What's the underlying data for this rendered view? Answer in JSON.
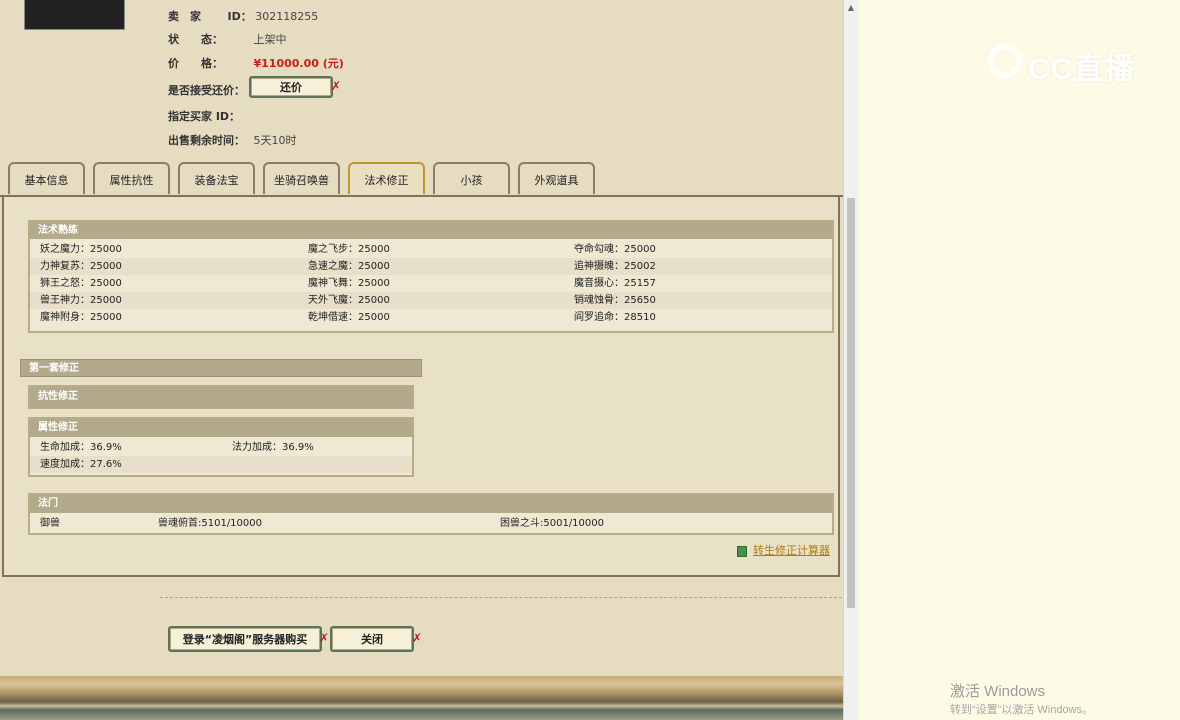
{
  "seller": {
    "seller_label": "卖　家",
    "seller_id_label": "ID：",
    "seller_id": "302118255",
    "status_label": "状　　态：",
    "status_value": "上架中",
    "price_label": "价　　格：",
    "price_value": "¥11000.00 (元)",
    "counter_label": "是否接受还价：",
    "counter_button": "还价",
    "buyer_label": "指定买家 ID：",
    "remaining_label": "出售剩余时间：",
    "remaining_value": "5天10时"
  },
  "tabs": [
    "基本信息",
    "属性抗性",
    "装备法宝",
    "坐骑召唤兽",
    "法术修正",
    "小孩",
    "外观道具"
  ],
  "active_tab": "法术修正",
  "spell_mastery": {
    "title": "法术熟练",
    "rows": [
      [
        "妖之魔力：25000",
        "魔之飞步：25000",
        "夺命勾魂：25000"
      ],
      [
        "力神复苏：25000",
        "急速之魔：25000",
        "追神摄魄：25002"
      ],
      [
        "狮王之怒：25000",
        "魔神飞舞：25000",
        "魔音摄心：25157"
      ],
      [
        "兽王神力：25000",
        "天外飞魔：25000",
        "销魂蚀骨：25650"
      ],
      [
        "魔神附身：25000",
        "乾坤借速：25000",
        "阎罗追命：28510"
      ]
    ]
  },
  "first_set": {
    "title": "第一套修正"
  },
  "resist_mod": {
    "title": "抗性修正"
  },
  "attr_mod": {
    "title": "属性修正",
    "rows": [
      [
        "生命加成：36.9%",
        "法力加成：36.9%"
      ],
      [
        "速度加成：27.6%",
        ""
      ]
    ]
  },
  "sect": {
    "title": "法门",
    "cols": [
      "御兽",
      "兽魂俯首:5101/10000",
      "困兽之斗:5001/10000"
    ]
  },
  "calc_link": "转生修正计算器",
  "footer": {
    "login_button": "登录“凌烟阁”服务器购买",
    "close_button": "关闭"
  },
  "watermark": {
    "logo_text": "CC直播",
    "win_line1": "激活 Windows",
    "win_line2": "转到“设置”以激活 Windows。"
  }
}
